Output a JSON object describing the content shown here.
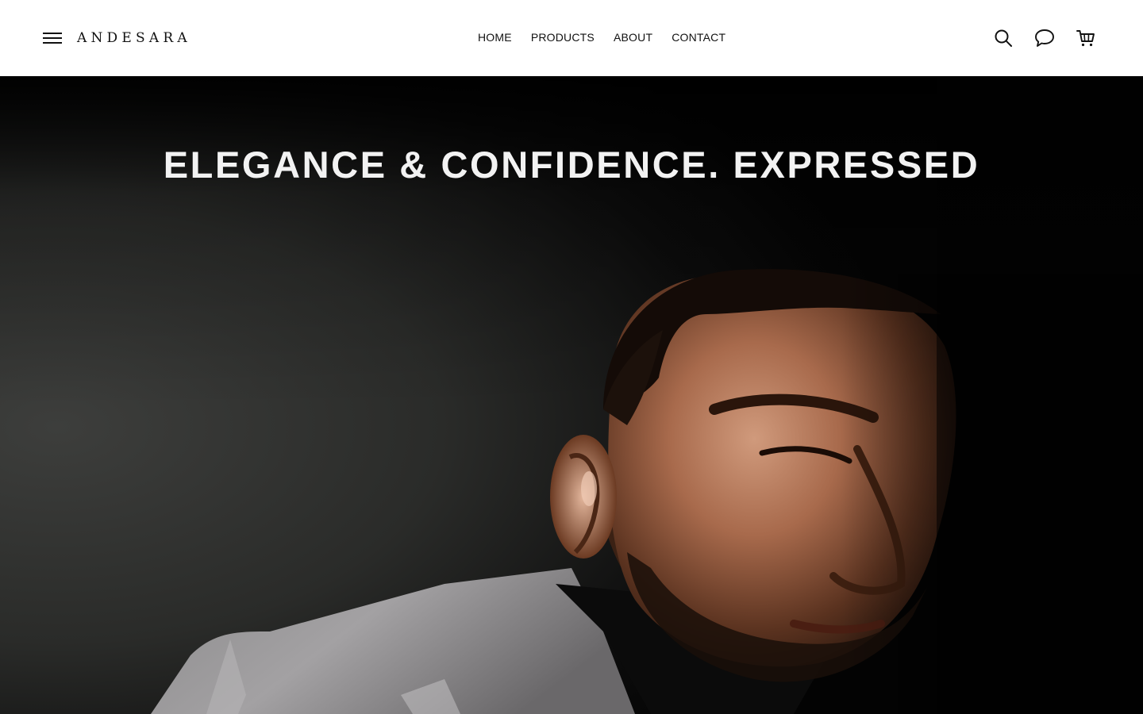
{
  "header": {
    "logo_text": "ANDESARA",
    "nav": [
      {
        "label": "HOME"
      },
      {
        "label": "PRODUCTS"
      },
      {
        "label": "ABOUT"
      },
      {
        "label": "CONTACT"
      }
    ],
    "icons": {
      "menu": "hamburger-menu-icon",
      "search": "search-icon",
      "chat": "chat-icon",
      "cart": "cart-icon"
    }
  },
  "hero": {
    "headline": "ELEGANCE & CONFIDENCE. EXPRESSED",
    "image": "portrait of a man in a grey suit jacket against a dark background"
  },
  "colors": {
    "header_bg": "#ffffff",
    "hero_bg": "#050505",
    "headline_text": "#f2f2f2",
    "nav_text": "#111111"
  }
}
